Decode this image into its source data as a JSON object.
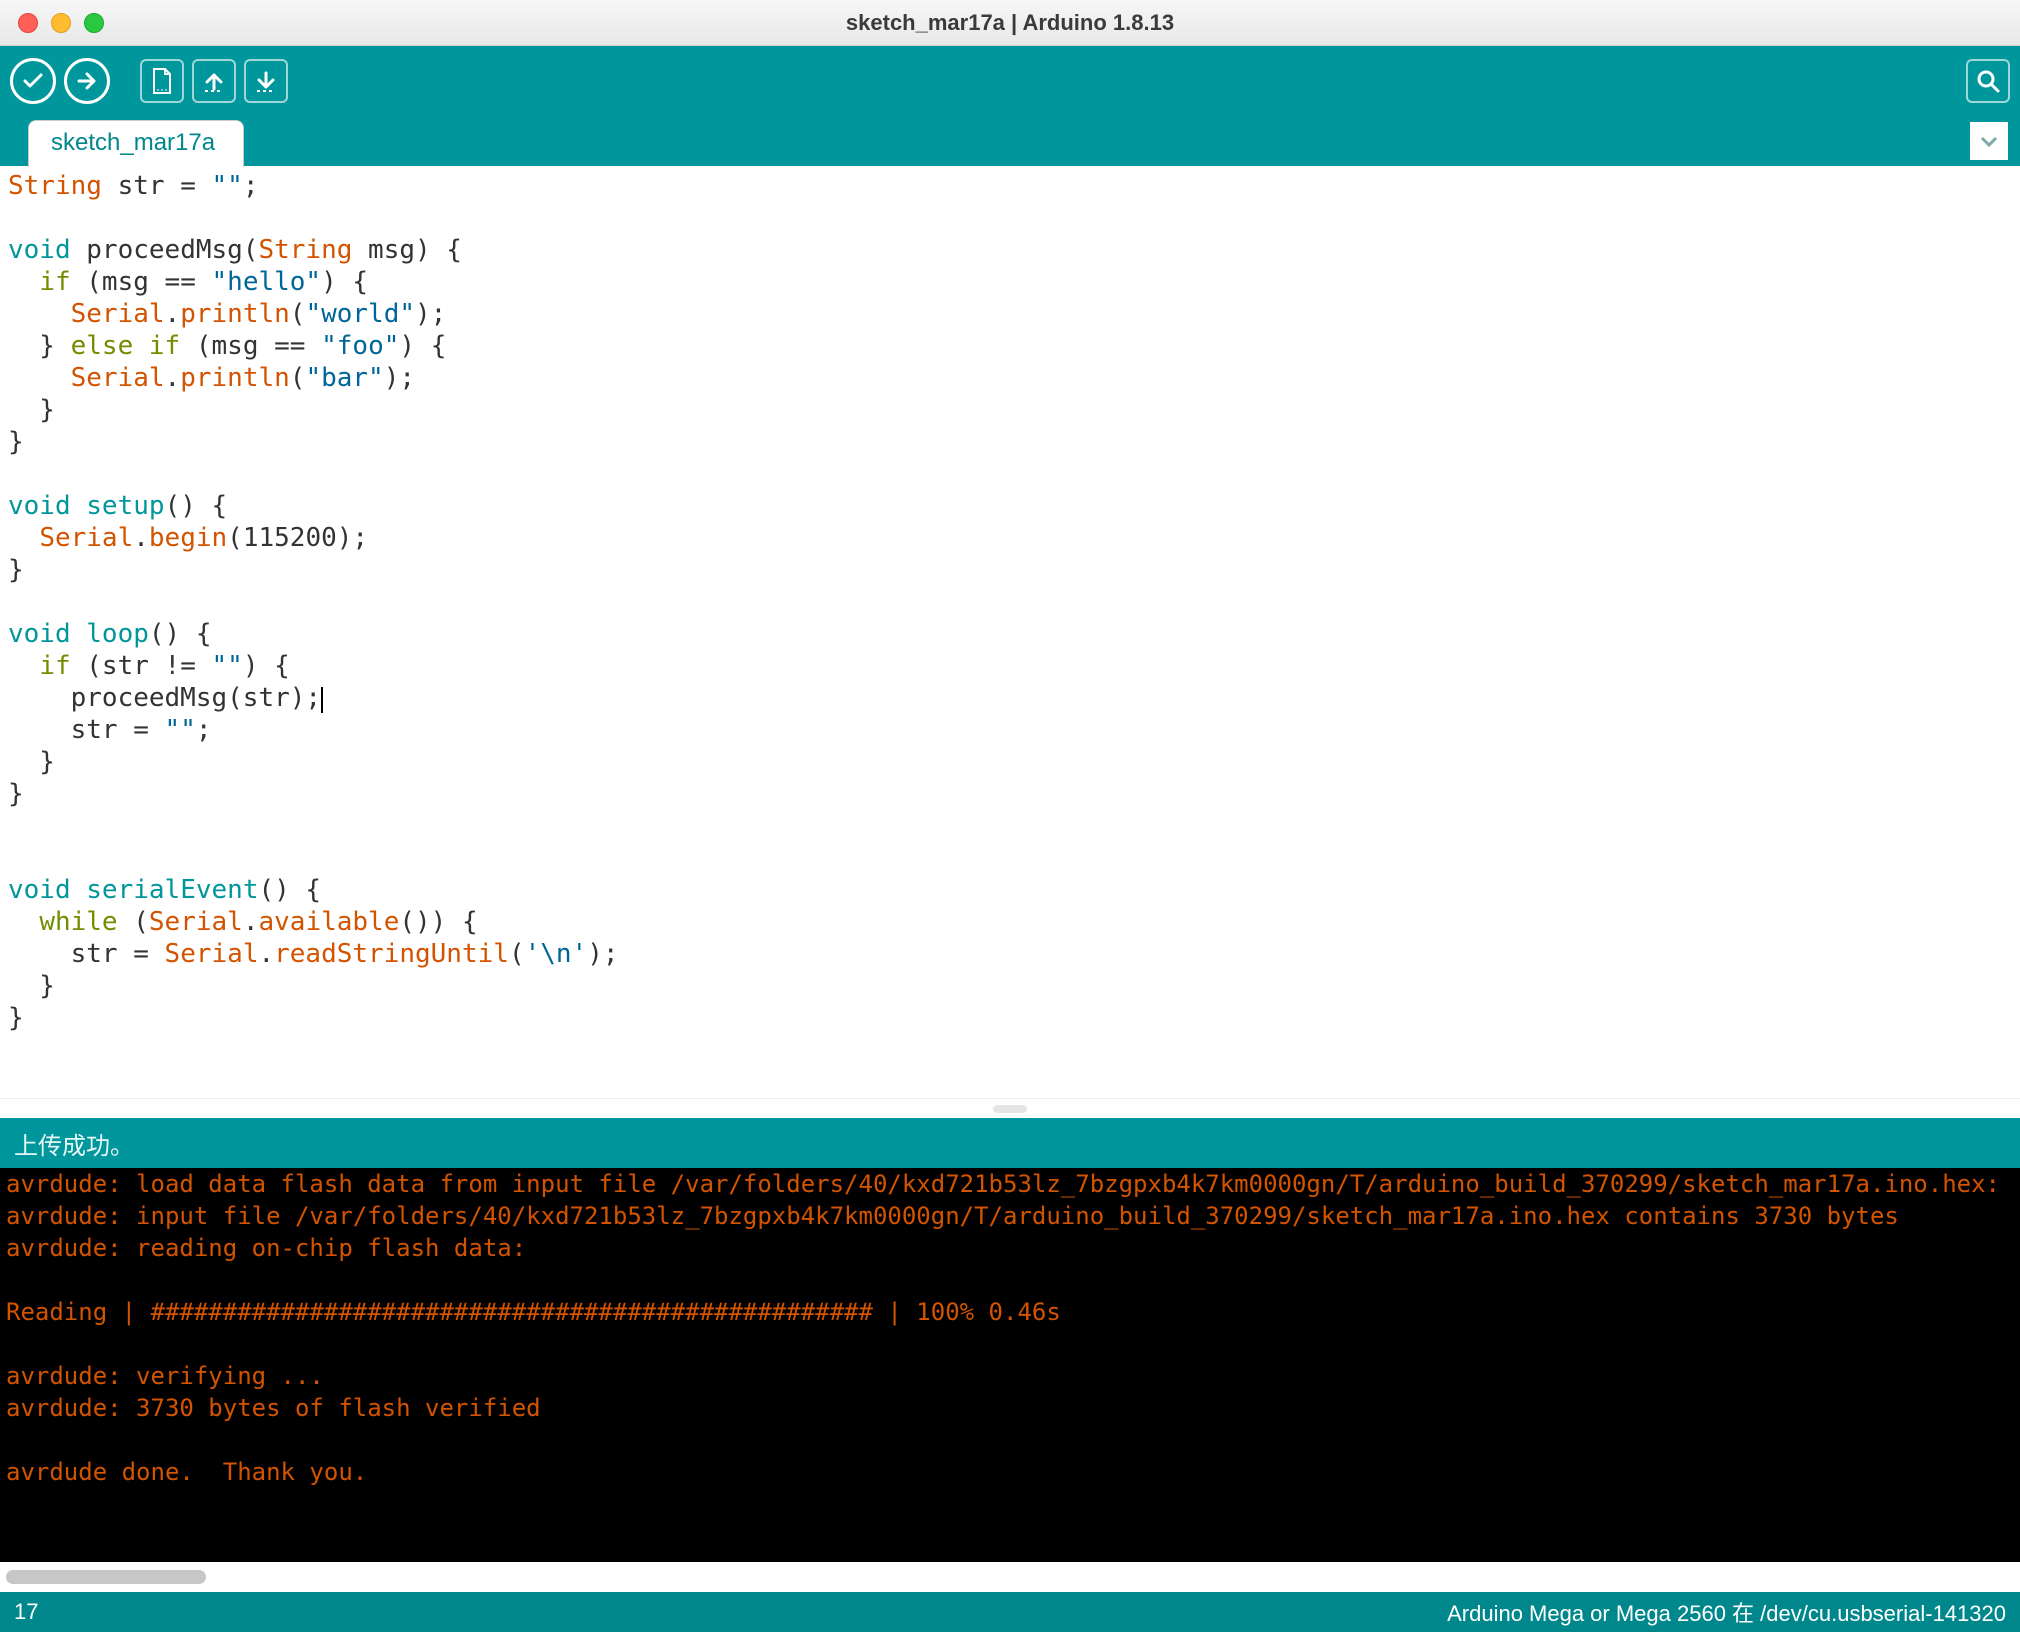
{
  "window": {
    "title": "sketch_mar17a | Arduino 1.8.13"
  },
  "toolbar": {
    "verify_tip": "Verify",
    "upload_tip": "Upload",
    "new_tip": "New",
    "open_tip": "Open",
    "save_tip": "Save",
    "serial_tip": "Serial Monitor"
  },
  "tabs": {
    "active": "sketch_mar17a"
  },
  "code": {
    "tokens": [
      [
        [
          "String",
          "t-type"
        ],
        [
          " str = ",
          ""
        ],
        [
          "\"\"",
          "t-str"
        ],
        [
          ";",
          ""
        ]
      ],
      [],
      [
        [
          "void",
          "t-kw"
        ],
        [
          " proceedMsg(",
          ""
        ],
        [
          "String",
          "t-type"
        ],
        [
          " msg) {",
          ""
        ]
      ],
      [
        [
          "  ",
          ""
        ],
        [
          "if",
          "t-ctrl"
        ],
        [
          " (msg == ",
          ""
        ],
        [
          "\"hello\"",
          "t-str"
        ],
        [
          ") {",
          ""
        ]
      ],
      [
        [
          "    ",
          ""
        ],
        [
          "Serial",
          "t-obj"
        ],
        [
          ".",
          ""
        ],
        [
          "println",
          "t-func"
        ],
        [
          "(",
          ""
        ],
        [
          "\"world\"",
          "t-str"
        ],
        [
          ");",
          ""
        ]
      ],
      [
        [
          "  } ",
          ""
        ],
        [
          "else",
          "t-ctrl"
        ],
        [
          " ",
          ""
        ],
        [
          "if",
          "t-ctrl"
        ],
        [
          " (msg == ",
          ""
        ],
        [
          "\"foo\"",
          "t-str"
        ],
        [
          ") {",
          ""
        ]
      ],
      [
        [
          "    ",
          ""
        ],
        [
          "Serial",
          "t-obj"
        ],
        [
          ".",
          ""
        ],
        [
          "println",
          "t-func"
        ],
        [
          "(",
          ""
        ],
        [
          "\"bar\"",
          "t-str"
        ],
        [
          ");",
          ""
        ]
      ],
      [
        [
          "  }",
          ""
        ]
      ],
      [
        [
          "}",
          ""
        ]
      ],
      [],
      [
        [
          "void",
          "t-kw"
        ],
        [
          " ",
          ""
        ],
        [
          "setup",
          "t-kw"
        ],
        [
          "() {",
          ""
        ]
      ],
      [
        [
          "  ",
          ""
        ],
        [
          "Serial",
          "t-obj"
        ],
        [
          ".",
          ""
        ],
        [
          "begin",
          "t-func"
        ],
        [
          "(115200);",
          ""
        ]
      ],
      [
        [
          "}",
          ""
        ]
      ],
      [],
      [
        [
          "void",
          "t-kw"
        ],
        [
          " ",
          ""
        ],
        [
          "loop",
          "t-kw"
        ],
        [
          "() {",
          ""
        ]
      ],
      [
        [
          "  ",
          ""
        ],
        [
          "if",
          "t-ctrl"
        ],
        [
          " (str != ",
          ""
        ],
        [
          "\"\"",
          "t-str"
        ],
        [
          ") {",
          ""
        ]
      ],
      [
        [
          "    proceedMsg(str);",
          ""
        ],
        [
          "|",
          "cursor-marker"
        ]
      ],
      [
        [
          "    str = ",
          ""
        ],
        [
          "\"\"",
          "t-str"
        ],
        [
          ";",
          ""
        ]
      ],
      [
        [
          "  }",
          ""
        ]
      ],
      [
        [
          "}",
          ""
        ]
      ],
      [],
      [],
      [
        [
          "void",
          "t-kw"
        ],
        [
          " ",
          ""
        ],
        [
          "serialEvent",
          "t-kw"
        ],
        [
          "() {",
          ""
        ]
      ],
      [
        [
          "  ",
          ""
        ],
        [
          "while",
          "t-ctrl"
        ],
        [
          " (",
          ""
        ],
        [
          "Serial",
          "t-obj"
        ],
        [
          ".",
          ""
        ],
        [
          "available",
          "t-func"
        ],
        [
          "()) {",
          ""
        ]
      ],
      [
        [
          "    str = ",
          ""
        ],
        [
          "Serial",
          "t-obj"
        ],
        [
          ".",
          ""
        ],
        [
          "readStringUntil",
          "t-func"
        ],
        [
          "(",
          ""
        ],
        [
          "'\\n'",
          "t-str"
        ],
        [
          ");",
          ""
        ]
      ],
      [
        [
          "  }",
          ""
        ]
      ],
      [
        [
          "}",
          ""
        ]
      ]
    ]
  },
  "status_message": "上传成功。",
  "console_lines": [
    "avrdude: load data flash data from input file /var/folders/40/kxd721b53lz_7bzgpxb4k7km0000gn/T/arduino_build_370299/sketch_mar17a.ino.hex:",
    "avrdude: input file /var/folders/40/kxd721b53lz_7bzgpxb4k7km0000gn/T/arduino_build_370299/sketch_mar17a.ino.hex contains 3730 bytes",
    "avrdude: reading on-chip flash data:",
    "",
    "Reading | ################################################## | 100% 0.46s",
    "",
    "avrdude: verifying ...",
    "avrdude: 3730 bytes of flash verified",
    "",
    "avrdude done.  Thank you.",
    ""
  ],
  "statusbar": {
    "line": "17",
    "board": "Arduino Mega or Mega 2560 在 /dev/cu.usbserial-141320"
  }
}
